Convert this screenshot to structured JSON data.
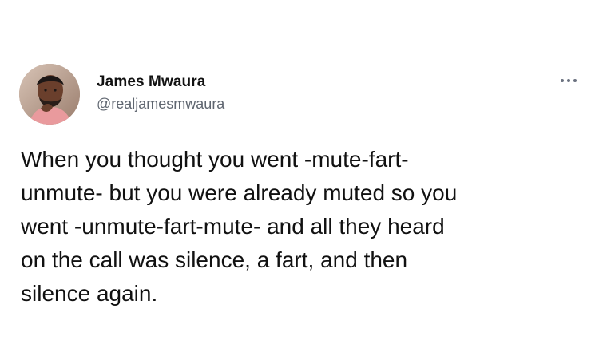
{
  "tweet": {
    "author": {
      "name": "James Mwaura",
      "handle": "@realjamesmwaura"
    },
    "more_icon": "more-horizontal-icon",
    "text_lines": [
      "When you thought you went -mute-fart-",
      "unmute- but you were already muted so you",
      "went -unmute-fart-mute- and all they heard",
      "on the call was silence, a fart, and then",
      "silence again."
    ]
  },
  "colors": {
    "background": "#ffffff",
    "text": "#111111",
    "handle": "#5f6670",
    "icon": "#6b7280"
  }
}
